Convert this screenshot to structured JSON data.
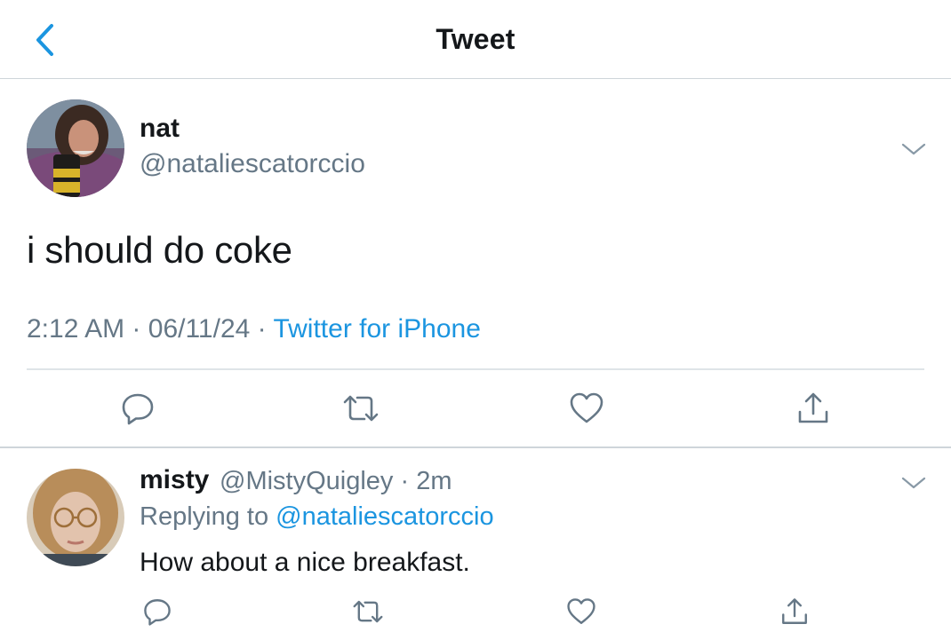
{
  "header": {
    "title": "Tweet",
    "back_icon": "chevron-left-icon"
  },
  "colors": {
    "accent": "#1b95e0",
    "text": "#14171a",
    "secondary": "#657786",
    "divider": "#cfd5da"
  },
  "tweet": {
    "name": "nat",
    "handle": "@nataliescatorccio",
    "text": "i should do coke",
    "time": "2:12 AM",
    "separator": "·",
    "date": "06/11/24",
    "source": "Twitter for iPhone",
    "actions": [
      "reply-icon",
      "retweet-icon",
      "like-icon",
      "share-icon"
    ]
  },
  "reply": {
    "name": "misty",
    "handle": "@MistyQuigley",
    "dot": "·",
    "age": "2m",
    "replying_prefix": "Replying to",
    "replying_mention": "@nataliescatorccio",
    "text": "How about a nice breakfast.",
    "actions": [
      "reply-icon",
      "retweet-icon",
      "like-icon",
      "share-icon"
    ]
  }
}
